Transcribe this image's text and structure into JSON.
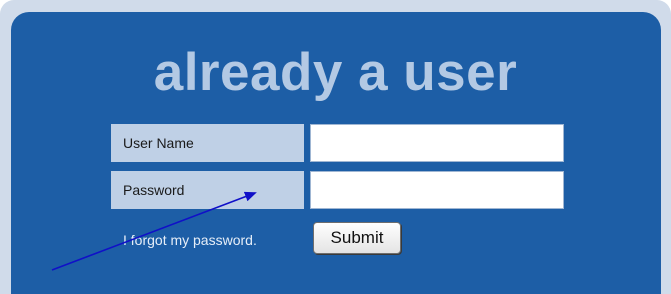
{
  "login": {
    "title": "already a user",
    "username_label": "User Name",
    "username_value": "",
    "password_label": "Password",
    "password_value": "",
    "forgot_link": "I forgot my password.",
    "submit_label": "Submit"
  },
  "colors": {
    "frame": "#d0dbea",
    "panel": "#1d5ea6",
    "title": "#b3c9e4",
    "label_bg": "#bfd0e6",
    "annotation_arrow": "#1010c8"
  },
  "icons": {
    "annotation": "arrow-annotation-icon"
  }
}
